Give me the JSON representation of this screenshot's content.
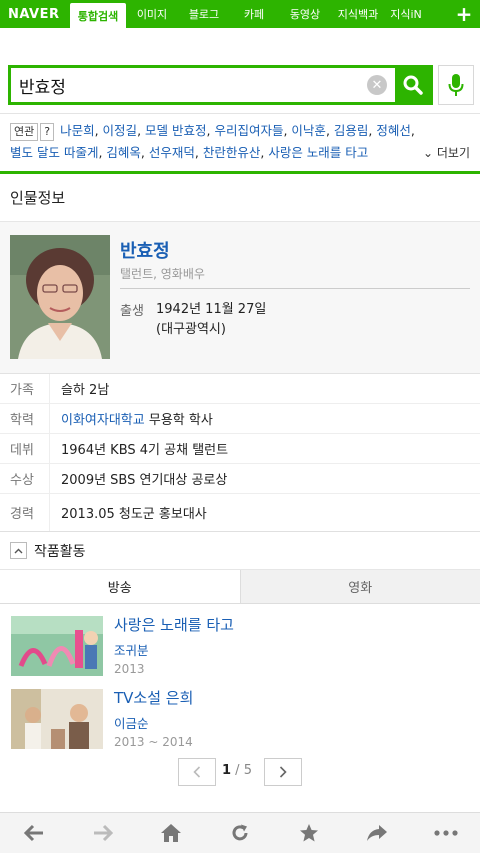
{
  "nav": {
    "logo": "NAVER",
    "tabs": [
      "통합검색",
      "이미지",
      "블로그",
      "카페",
      "동영상",
      "지식백과",
      "지식iN"
    ],
    "plus": "+"
  },
  "search": {
    "query": "반효정",
    "placeholder": ""
  },
  "related": {
    "label": "연관",
    "help": "?",
    "items": [
      "나문희",
      "이정길",
      "모델 반효정",
      "우리집여자들",
      "이낙훈",
      "김용림",
      "정혜선",
      "별도 달도 따줄게",
      "김혜옥",
      "선우재덕",
      "찬란한유산",
      "사랑은 노래를 타고"
    ],
    "more": "더보기"
  },
  "section_title": "인물정보",
  "profile": {
    "name": "반효정",
    "job": "탤런트, 영화배우",
    "birth_label": "출생",
    "birth_date": "1942년 11월 27일",
    "birth_place": "(대구광역시)"
  },
  "info": [
    {
      "key": "가족",
      "value": "슬하 2남"
    },
    {
      "key": "학력",
      "link": "이화여자대학교",
      "value": " 무용학 학사"
    },
    {
      "key": "데뷔",
      "value": "1964년 KBS 4기 공채 탤런트"
    },
    {
      "key": "수상",
      "value": "2009년 SBS 연기대상 공로상"
    },
    {
      "key": "경력",
      "value": "2013.05 청도군 홍보대사"
    }
  ],
  "works": {
    "title": "작품활동",
    "tabs": [
      "방송",
      "영화"
    ],
    "items": [
      {
        "title": "사랑은 노래를 타고",
        "role": "조귀분",
        "year": "2013"
      },
      {
        "title": "TV소설 은희",
        "role": "이금순",
        "year": "2013 ~ 2014"
      }
    ],
    "page_current": "1",
    "page_sep": " / ",
    "page_total": "5"
  },
  "colors": {
    "brand": "#2db400",
    "link": "#1a5fb4"
  }
}
